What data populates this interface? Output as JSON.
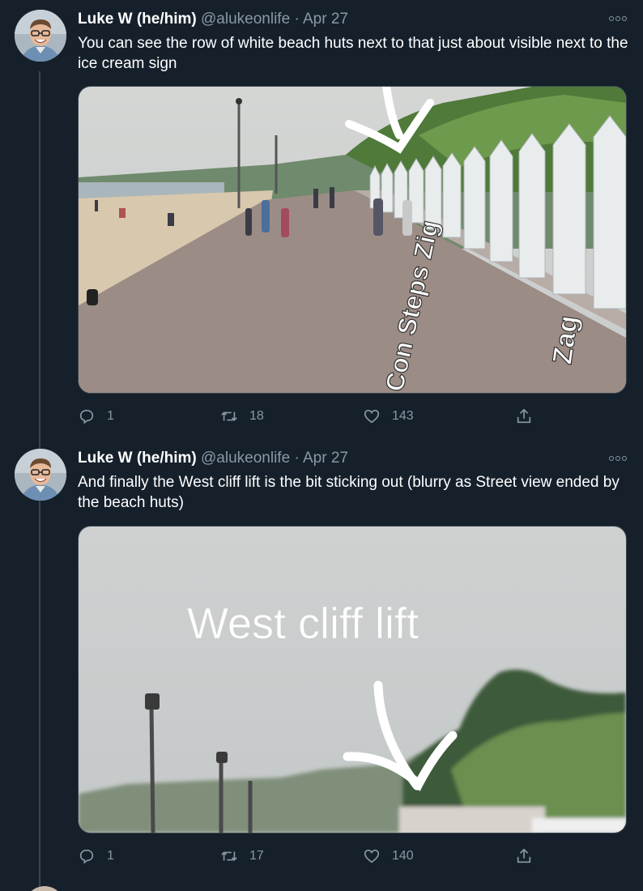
{
  "tweets": [
    {
      "author_name": "Luke W (he/him)",
      "handle": "@alukeonlife",
      "separator": "·",
      "date": "Apr 27",
      "text": "You can see the row of white beach huts next to that just about visible next to the ice cream sign",
      "media_overlay_text": [
        "Con Steps Zig",
        "Zag"
      ],
      "replies": "1",
      "retweets": "18",
      "likes": "143"
    },
    {
      "author_name": "Luke W (he/him)",
      "handle": "@alukeonlife",
      "separator": "·",
      "date": "Apr 27",
      "text": "And finally the West cliff lift is the bit sticking out (blurry as Street view ended by the beach huts)",
      "media_overlay_text": [
        "West cliff lift"
      ],
      "replies": "1",
      "retweets": "17",
      "likes": "140"
    }
  ],
  "icons": {
    "reply": "reply-icon",
    "retweet": "retweet-icon",
    "like": "heart-icon",
    "share": "share-icon",
    "more": "more-options-icon"
  },
  "colors": {
    "background": "#15202b",
    "secondary_text": "#8899a6",
    "border": "#38444d"
  }
}
